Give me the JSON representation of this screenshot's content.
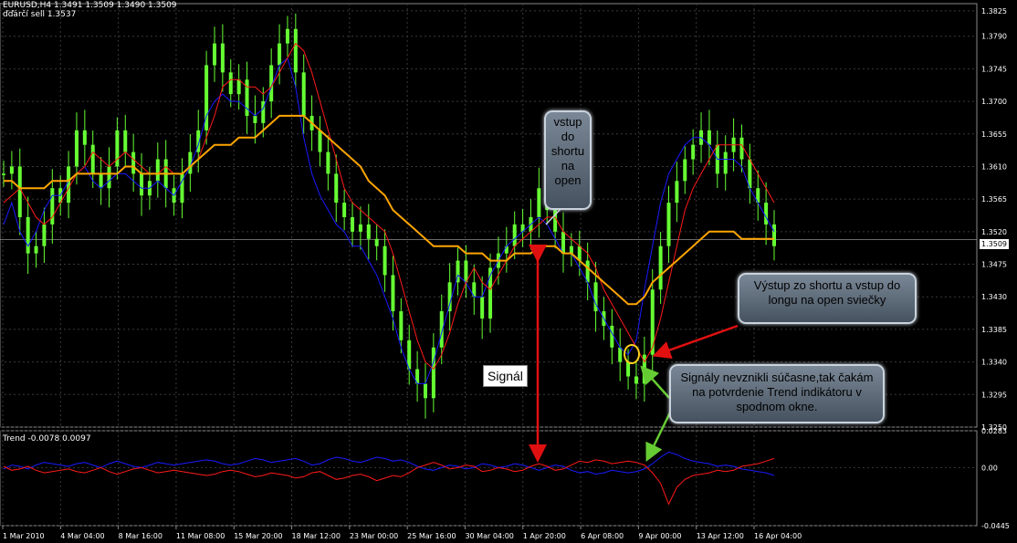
{
  "header": {
    "symbol_line": "EURUSD,H4  1.3491 1.3509 1.3490 1.3509",
    "indicator_line": "ďďárčí sell 1.3537",
    "subwindow_label": "Trend -0.0078 0.0097"
  },
  "current_price_label": "1.3509",
  "annotations": {
    "entry_short": "vstup do shortu na open",
    "exit_short_entry_long": "Výstup zo shortu a vstup do longu na open sviečky",
    "signals_not_simultaneous": "Signály nevznikli súčasne,tak čakám na potvrdenie Trend indikátoru v spodnom okne.",
    "signal_label": "Signál"
  },
  "colors": {
    "candles": "#66ff33",
    "blue_line": "#1a1aff",
    "red_line": "#ff1a1a",
    "orange_ma": "#ffa500",
    "grid": "#3a3a3a",
    "signal_arrow": "#e01010",
    "confirm_arrow": "#66cc33"
  },
  "chart_data": [
    {
      "type": "line",
      "name": "main",
      "x_tick_labels": [
        "1 Mar 2010",
        "4 Mar 04:00",
        "8 Mar 16:00",
        "11 Mar 08:00",
        "15 Mar 20:00",
        "18 Mar 12:00",
        "23 Mar 00:00",
        "25 Mar 16:00",
        "30 Mar 04:00",
        "1 Apr 20:00",
        "6 Apr 08:00",
        "9 Apr 00:00",
        "13 Apr 12:00",
        "16 Apr 04:00"
      ],
      "y_tick_labels": [
        "1.3825",
        "1.3790",
        "1.3745",
        "1.3700",
        "1.3655",
        "1.3610",
        "1.3565",
        "1.3520",
        "1.3475",
        "1.3430",
        "1.3385",
        "1.3340",
        "1.3295",
        "1.3250"
      ],
      "ylim": [
        1.325,
        1.3835
      ],
      "current_price": 1.3509,
      "series": [
        {
          "name": "price",
          "values": [
            1.36,
            1.361,
            1.354,
            1.349,
            1.35,
            1.353,
            1.358,
            1.356,
            1.361,
            1.366,
            1.364,
            1.36,
            1.358,
            1.361,
            1.366,
            1.363,
            1.36,
            1.357,
            1.359,
            1.362,
            1.358,
            1.356,
            1.36,
            1.363,
            1.366,
            1.375,
            1.378,
            1.374,
            1.371,
            1.373,
            1.368,
            1.367,
            1.37,
            1.375,
            1.378,
            1.38,
            1.374,
            1.368,
            1.366,
            1.363,
            1.36,
            1.356,
            1.354,
            1.352,
            1.353,
            1.351,
            1.35,
            1.346,
            1.341,
            1.337,
            1.333,
            1.331,
            1.329,
            1.336,
            1.341,
            1.345,
            1.348,
            1.345,
            1.343,
            1.34,
            1.347,
            1.349,
            1.35,
            1.353,
            1.352,
            1.354,
            1.358,
            1.355,
            1.352,
            1.349,
            1.35,
            1.348,
            1.345,
            1.341,
            1.339,
            1.336,
            1.334,
            1.332,
            1.331,
            1.335,
            1.344,
            1.35,
            1.356,
            1.359,
            1.362,
            1.364,
            1.366,
            1.364,
            1.36,
            1.363,
            1.365,
            1.362,
            1.358,
            1.356,
            1.353,
            1.35
          ]
        },
        {
          "name": "blue",
          "values": [
            1.353,
            1.356,
            1.352,
            1.35,
            1.352,
            1.355,
            1.357,
            1.357,
            1.359,
            1.36,
            1.361,
            1.359,
            1.358,
            1.359,
            1.36,
            1.36,
            1.359,
            1.358,
            1.358,
            1.359,
            1.358,
            1.357,
            1.359,
            1.361,
            1.364,
            1.368,
            1.37,
            1.371,
            1.37,
            1.37,
            1.369,
            1.368,
            1.369,
            1.372,
            1.375,
            1.376,
            1.372,
            1.365,
            1.36,
            1.357,
            1.355,
            1.353,
            1.352,
            1.35,
            1.35,
            1.348,
            1.346,
            1.343,
            1.34,
            1.336,
            1.333,
            1.331,
            1.331,
            1.334,
            1.338,
            1.342,
            1.346,
            1.345,
            1.343,
            1.343,
            1.346,
            1.348,
            1.35,
            1.351,
            1.352,
            1.353,
            1.354,
            1.353,
            1.351,
            1.349,
            1.349,
            1.347,
            1.345,
            1.342,
            1.34,
            1.338,
            1.336,
            1.335,
            1.337,
            1.344,
            1.35,
            1.356,
            1.36,
            1.362,
            1.364,
            1.365,
            1.365,
            1.364,
            1.362,
            1.362,
            1.362,
            1.361,
            1.358,
            1.356,
            1.354,
            1.352
          ]
        },
        {
          "name": "red",
          "values": [
            1.356,
            1.357,
            1.358,
            1.356,
            1.354,
            1.353,
            1.354,
            1.356,
            1.358,
            1.36,
            1.361,
            1.363,
            1.362,
            1.361,
            1.362,
            1.363,
            1.362,
            1.361,
            1.36,
            1.36,
            1.361,
            1.36,
            1.36,
            1.361,
            1.362,
            1.365,
            1.368,
            1.372,
            1.373,
            1.373,
            1.372,
            1.372,
            1.371,
            1.372,
            1.374,
            1.376,
            1.378,
            1.377,
            1.374,
            1.37,
            1.366,
            1.362,
            1.358,
            1.356,
            1.355,
            1.354,
            1.353,
            1.352,
            1.349,
            1.345,
            1.341,
            1.337,
            1.334,
            1.333,
            1.335,
            1.338,
            1.342,
            1.345,
            1.347,
            1.345,
            1.344,
            1.346,
            1.348,
            1.35,
            1.351,
            1.352,
            1.353,
            1.354,
            1.354,
            1.352,
            1.351,
            1.35,
            1.349,
            1.347,
            1.344,
            1.342,
            1.34,
            1.338,
            1.336,
            1.334,
            1.336,
            1.34,
            1.345,
            1.35,
            1.355,
            1.358,
            1.36,
            1.362,
            1.364,
            1.364,
            1.364,
            1.364,
            1.362,
            1.36,
            1.358,
            1.356
          ]
        },
        {
          "name": "orange",
          "values": [
            1.359,
            1.359,
            1.358,
            1.358,
            1.358,
            1.358,
            1.359,
            1.359,
            1.359,
            1.36,
            1.36,
            1.36,
            1.36,
            1.36,
            1.36,
            1.361,
            1.361,
            1.36,
            1.36,
            1.36,
            1.36,
            1.36,
            1.36,
            1.361,
            1.362,
            1.363,
            1.364,
            1.364,
            1.364,
            1.365,
            1.365,
            1.365,
            1.366,
            1.367,
            1.368,
            1.368,
            1.368,
            1.368,
            1.367,
            1.366,
            1.365,
            1.364,
            1.363,
            1.362,
            1.361,
            1.359,
            1.358,
            1.357,
            1.355,
            1.354,
            1.353,
            1.352,
            1.351,
            1.35,
            1.35,
            1.35,
            1.35,
            1.349,
            1.349,
            1.349,
            1.348,
            1.348,
            1.348,
            1.349,
            1.349,
            1.349,
            1.35,
            1.35,
            1.35,
            1.349,
            1.349,
            1.348,
            1.347,
            1.346,
            1.345,
            1.344,
            1.343,
            1.342,
            1.342,
            1.343,
            1.345,
            1.346,
            1.347,
            1.348,
            1.349,
            1.35,
            1.351,
            1.352,
            1.352,
            1.352,
            1.352,
            1.351,
            1.351,
            1.351,
            1.351,
            1.351
          ]
        }
      ]
    },
    {
      "type": "line",
      "name": "Trend",
      "y_tick_labels": [
        "0.0283",
        "0.00",
        "-0.0445"
      ],
      "ylim": [
        -0.0445,
        0.0283
      ],
      "series": [
        {
          "name": "blue",
          "values": [
            -0.001,
            0.002,
            0.001,
            -0.001,
            0.002,
            0.004,
            0.003,
            0.002,
            0.001,
            0.003,
            0.004,
            0.002,
            0.0,
            0.003,
            0.005,
            0.003,
            0.001,
            0.0,
            0.002,
            0.004,
            0.003,
            0.002,
            0.003,
            0.004,
            0.005,
            0.006,
            0.005,
            0.003,
            0.002,
            0.003,
            0.005,
            0.007,
            0.006,
            0.004,
            0.005,
            0.006,
            0.007,
            0.005,
            0.002,
            0.003,
            0.006,
            0.008,
            0.007,
            0.005,
            0.004,
            0.006,
            0.008,
            0.007,
            0.005,
            0.006,
            0.004,
            0.001,
            -0.001,
            -0.002,
            0.0,
            0.002,
            0.001,
            -0.001,
            0.0,
            0.003,
            0.002,
            0.0,
            0.001,
            0.003,
            0.002,
            0.0,
            -0.002,
            0.0,
            0.002,
            0.001,
            -0.002,
            -0.004,
            -0.003,
            -0.005,
            -0.004,
            -0.002,
            -0.003,
            -0.004,
            -0.003,
            -0.001,
            0.003,
            0.008,
            0.012,
            0.01,
            0.007,
            0.005,
            0.004,
            0.003,
            0.001,
            0.002,
            0.001,
            -0.001,
            -0.002,
            -0.003,
            -0.004,
            -0.006
          ]
        },
        {
          "name": "red",
          "values": [
            0.001,
            -0.002,
            -0.001,
            0.001,
            -0.002,
            -0.004,
            -0.003,
            -0.002,
            -0.001,
            -0.003,
            -0.004,
            -0.002,
            0.0,
            -0.003,
            -0.005,
            -0.003,
            -0.001,
            0.0,
            -0.002,
            -0.004,
            -0.003,
            -0.002,
            -0.003,
            -0.004,
            -0.005,
            -0.006,
            -0.005,
            -0.003,
            -0.002,
            -0.003,
            -0.005,
            -0.007,
            -0.006,
            -0.004,
            -0.005,
            -0.006,
            -0.008,
            -0.007,
            -0.004,
            -0.003,
            -0.006,
            -0.009,
            -0.008,
            -0.006,
            -0.005,
            -0.007,
            -0.01,
            -0.008,
            -0.006,
            -0.007,
            -0.004,
            0.0,
            0.002,
            0.004,
            0.002,
            -0.001,
            0.0,
            0.002,
            0.001,
            -0.003,
            -0.002,
            0.0,
            -0.001,
            -0.003,
            -0.002,
            0.001,
            0.003,
            0.001,
            -0.002,
            -0.001,
            0.002,
            0.005,
            0.004,
            0.006,
            0.005,
            0.003,
            0.004,
            0.005,
            0.004,
            0.002,
            -0.004,
            -0.012,
            -0.028,
            -0.015,
            -0.009,
            -0.006,
            -0.005,
            -0.004,
            -0.002,
            -0.003,
            -0.002,
            0.001,
            0.002,
            0.003,
            0.005,
            0.007
          ]
        }
      ]
    }
  ]
}
